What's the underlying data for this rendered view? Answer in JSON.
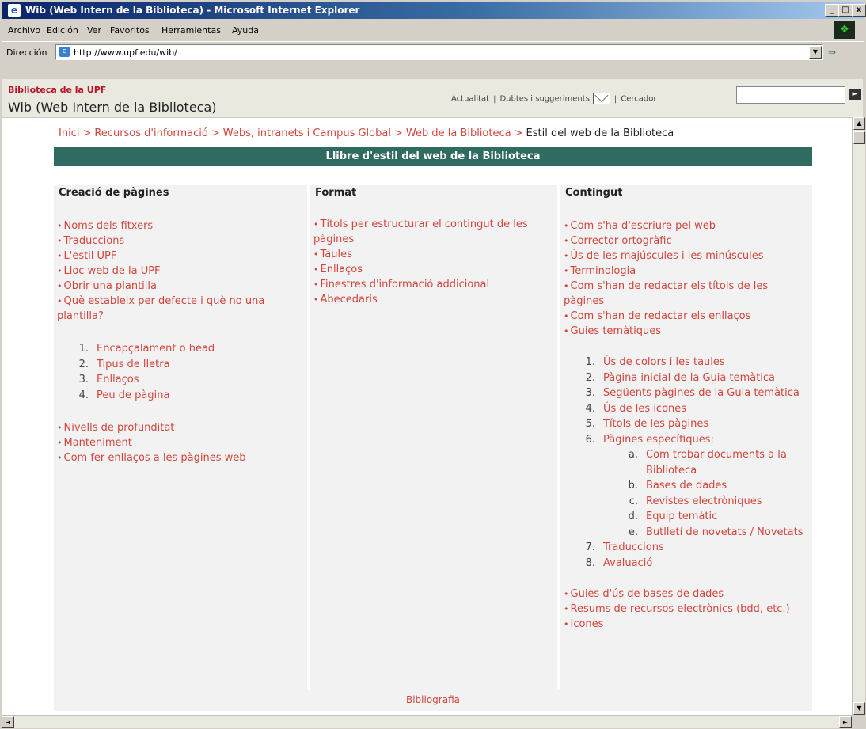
{
  "window": {
    "title": "Wib (Web Intern de la Biblioteca) - Microsoft Internet Explorer",
    "min": "_",
    "max": "□",
    "close": "x"
  },
  "menu": [
    "Archivo",
    "Edición",
    "Ver",
    "Favoritos",
    "Herramientas",
    "Ayuda"
  ],
  "address": {
    "label": "Dirección",
    "url": "http://www.upf.edu/wib/",
    "go": "⇒"
  },
  "header": {
    "site_label": "Biblioteca de la UPF",
    "site_title": "Wib (Web Intern de la Biblioteca)",
    "link_news": "Actualitat",
    "link_questions": "Dubtes i suggeriments",
    "search_label": "Cercador",
    "search_value": ""
  },
  "breadcrumb": {
    "items": [
      "Inici",
      "Recursos d'informació",
      "Webs, intranets i Campus Global",
      "Web de la Biblioteca"
    ],
    "current": "Estil del web de la Biblioteca"
  },
  "banner": "Llibre d'estil del web de la Biblioteca",
  "col1": {
    "title": "Creació de pàgines",
    "bullets_a": [
      "Noms dels fitxers",
      "Traduccions",
      "L'estil UPF",
      "Lloc web de la UPF",
      "Obrir una plantilla",
      "Què estableix per defecte i què no una plantilla?"
    ],
    "numbered": [
      {
        "n": "1.",
        "t": "Encapçalament o head"
      },
      {
        "n": "2.",
        "t": "Tipus de lletra"
      },
      {
        "n": "3.",
        "t": "Enllaços"
      },
      {
        "n": "4.",
        "t": "Peu de pàgina"
      }
    ],
    "bullets_b": [
      "Nivells de profunditat",
      "Manteniment",
      "Com fer enllaços a les pàgines web"
    ]
  },
  "col2": {
    "title": "Format",
    "bullets": [
      "Títols per estructurar el contingut de les pàgines",
      "Taules",
      "Enllaços",
      "Finestres d'informació addicional",
      "Abecedaris"
    ]
  },
  "col3": {
    "title": "Contingut",
    "bullets_a": [
      "Com s'ha d'escriure pel web",
      "Corrector ortogràfic",
      "Ús de les majúscules i les minúscules",
      "Terminologia",
      "Com s'han de redactar els títols de les pàgines",
      "Com s'han de redactar els enllaços",
      "Guies temàtiques"
    ],
    "numbered_a": [
      {
        "n": "1.",
        "t": "Ús de colors i les taules"
      },
      {
        "n": "2.",
        "t": "Pàgina inicial de la Guia temàtica"
      },
      {
        "n": "3.",
        "t": "Següents pàgines de la Guia temàtica"
      },
      {
        "n": "4.",
        "t": "Ús de les icones"
      },
      {
        "n": "5.",
        "t": "Títols de les pàgines"
      },
      {
        "n": "6.",
        "t": "Pàgines específiques:"
      }
    ],
    "sub": [
      {
        "n": "a.",
        "t": "Com trobar documents a la Biblioteca"
      },
      {
        "n": "b.",
        "t": "Bases de dades"
      },
      {
        "n": "c.",
        "t": "Revistes electròniques"
      },
      {
        "n": "d.",
        "t": "Equip temàtic"
      },
      {
        "n": "e.",
        "t": "Butlletí de novetats / Novetats"
      }
    ],
    "numbered_b": [
      {
        "n": "7.",
        "t": "Traduccions"
      },
      {
        "n": "8.",
        "t": "Avaluació"
      }
    ],
    "bullets_b": [
      "Guies d'ús de bases de dades",
      "Resums de recursos electrònics (bdd, etc.)",
      "Icones"
    ]
  },
  "footer": {
    "link": "Bibliografia"
  },
  "colors": {
    "link": "#d0453c",
    "banner": "#2f6b60",
    "column_bg": "#f2f2f2"
  }
}
